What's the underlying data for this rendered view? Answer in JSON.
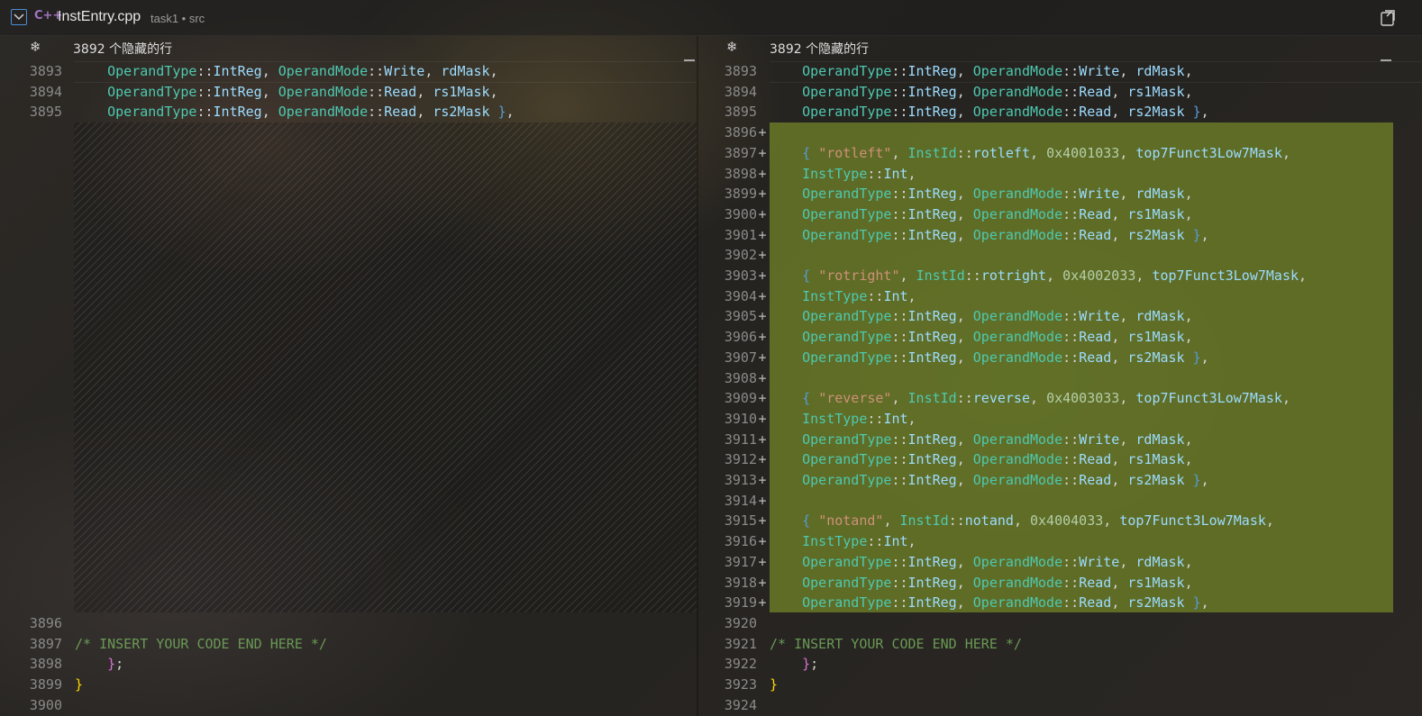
{
  "title_bar": {
    "file_name": "InstEntry.cpp",
    "file_desc": "task1 • src",
    "language_icon": "cpp-icon"
  },
  "left_pane": {
    "hidden_lines_label": "3892 个隐藏的行",
    "lines": [
      {
        "num": "3893",
        "code": "    OperandType::IntReg, OperandMode::Write, rdMask,"
      },
      {
        "num": "3894",
        "code": "    OperandType::IntReg, OperandMode::Read, rs1Mask,"
      },
      {
        "num": "3895",
        "code": "    OperandType::IntReg, OperandMode::Read, rs2Mask },"
      },
      {
        "num": "3896",
        "code": ""
      },
      {
        "num": "3897",
        "code": "/* INSERT YOUR CODE END HERE */"
      },
      {
        "num": "3898",
        "code": "    };"
      },
      {
        "num": "3899",
        "code": "}"
      },
      {
        "num": "3900",
        "code": ""
      }
    ]
  },
  "right_pane": {
    "hidden_lines_label": "3892 个隐藏的行",
    "lines": [
      {
        "num": "3893",
        "code": "    OperandType::IntReg, OperandMode::Write, rdMask,",
        "added": false
      },
      {
        "num": "3894",
        "code": "    OperandType::IntReg, OperandMode::Read, rs1Mask,",
        "added": false
      },
      {
        "num": "3895",
        "code": "    OperandType::IntReg, OperandMode::Read, rs2Mask },",
        "added": false
      },
      {
        "num": "3896",
        "code": "",
        "added": true
      },
      {
        "num": "3897",
        "code": "    { \"rotleft\", InstId::rotleft, 0x4001033, top7Funct3Low7Mask,",
        "added": true
      },
      {
        "num": "3898",
        "code": "    InstType::Int,",
        "added": true
      },
      {
        "num": "3899",
        "code": "    OperandType::IntReg, OperandMode::Write, rdMask,",
        "added": true
      },
      {
        "num": "3900",
        "code": "    OperandType::IntReg, OperandMode::Read, rs1Mask,",
        "added": true
      },
      {
        "num": "3901",
        "code": "    OperandType::IntReg, OperandMode::Read, rs2Mask },",
        "added": true
      },
      {
        "num": "3902",
        "code": "",
        "added": true
      },
      {
        "num": "3903",
        "code": "    { \"rotright\", InstId::rotright, 0x4002033, top7Funct3Low7Mask,",
        "added": true
      },
      {
        "num": "3904",
        "code": "    InstType::Int,",
        "added": true
      },
      {
        "num": "3905",
        "code": "    OperandType::IntReg, OperandMode::Write, rdMask,",
        "added": true
      },
      {
        "num": "3906",
        "code": "    OperandType::IntReg, OperandMode::Read, rs1Mask,",
        "added": true
      },
      {
        "num": "3907",
        "code": "    OperandType::IntReg, OperandMode::Read, rs2Mask },",
        "added": true
      },
      {
        "num": "3908",
        "code": "",
        "added": true
      },
      {
        "num": "3909",
        "code": "    { \"reverse\", InstId::reverse, 0x4003033, top7Funct3Low7Mask,",
        "added": true
      },
      {
        "num": "3910",
        "code": "    InstType::Int,",
        "added": true
      },
      {
        "num": "3911",
        "code": "    OperandType::IntReg, OperandMode::Write, rdMask,",
        "added": true
      },
      {
        "num": "3912",
        "code": "    OperandType::IntReg, OperandMode::Read, rs1Mask,",
        "added": true
      },
      {
        "num": "3913",
        "code": "    OperandType::IntReg, OperandMode::Read, rs2Mask },",
        "added": true
      },
      {
        "num": "3914",
        "code": "",
        "added": true
      },
      {
        "num": "3915",
        "code": "    { \"notand\", InstId::notand, 0x4004033, top7Funct3Low7Mask,",
        "added": true
      },
      {
        "num": "3916",
        "code": "    InstType::Int,",
        "added": true
      },
      {
        "num": "3917",
        "code": "    OperandType::IntReg, OperandMode::Write, rdMask,",
        "added": true
      },
      {
        "num": "3918",
        "code": "    OperandType::IntReg, OperandMode::Read, rs1Mask,",
        "added": true
      },
      {
        "num": "3919",
        "code": "    OperandType::IntReg, OperandMode::Read, rs2Mask },",
        "added": true
      },
      {
        "num": "3920",
        "code": "",
        "added": false
      },
      {
        "num": "3921",
        "code": "/* INSERT YOUR CODE END HERE */",
        "added": false
      },
      {
        "num": "3922",
        "code": "    };",
        "added": false
      },
      {
        "num": "3923",
        "code": "}",
        "added": false
      },
      {
        "num": "3924",
        "code": "",
        "added": false
      }
    ],
    "added_marker": "+"
  },
  "colors": {
    "type": "#4ec9b0",
    "identifier": "#9cdcfe",
    "string": "#ce9178",
    "number": "#b5cea8",
    "comment": "#6a9955",
    "inserted_background": "#6e8028"
  }
}
